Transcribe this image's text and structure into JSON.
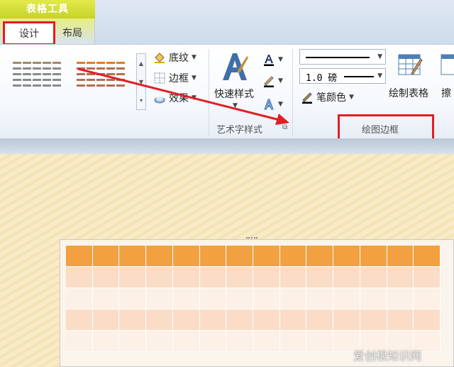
{
  "context_tab": {
    "title": "表格工具"
  },
  "tabs": [
    {
      "label": "设计"
    },
    {
      "label": "布局"
    }
  ],
  "ribbon": {
    "shading_label": "底纹",
    "borders_label": "边框",
    "effects_label": "效果",
    "quick_styles_label": "快速样式",
    "wordart_group_label": "艺术字样式",
    "pen_weight": "1.0 磅",
    "pen_color_label": "笔颜色",
    "draw_table_label": "绘制表格",
    "eraser_label": "擦",
    "draw_borders_group_label": "绘图边框"
  },
  "colors": {
    "highlight": "#e31d24",
    "table_header": "#f2a040"
  },
  "watermark": "爱创根知识网"
}
